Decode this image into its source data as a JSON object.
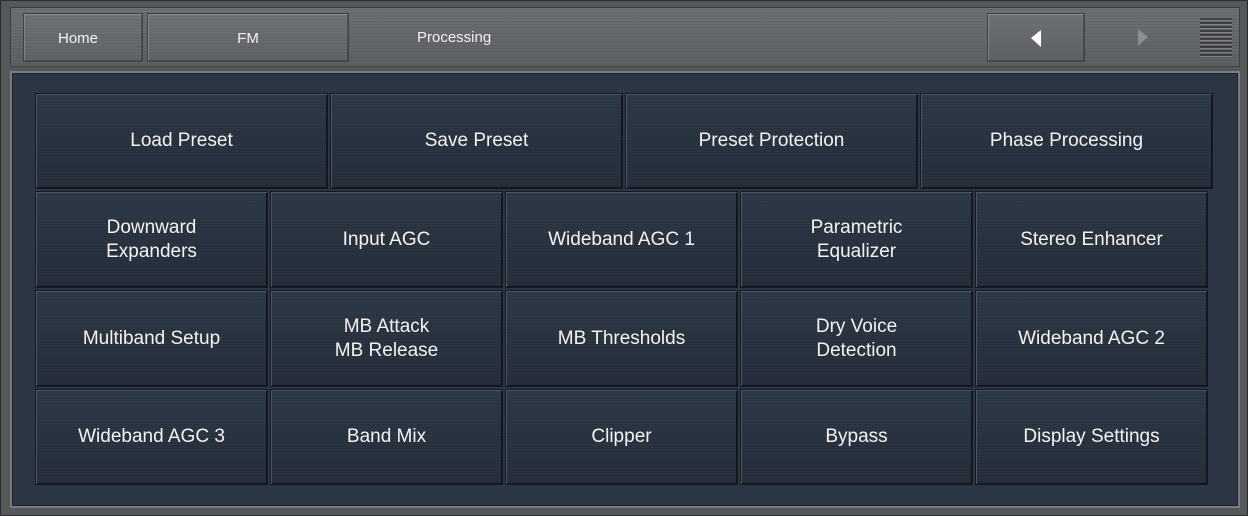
{
  "breadcrumb": {
    "home": "Home",
    "fm": "FM",
    "current": "Processing"
  },
  "nav": {
    "prev_icon": "chevron-left-icon",
    "next_icon": "chevron-right-icon",
    "menu_icon": "menu-lines-icon"
  },
  "colors": {
    "panel_bg": "#2b3543",
    "button_text": "#f1f3f5",
    "topbar_bg": "#63666a"
  },
  "rows": [
    [
      "Load Preset",
      "Save Preset",
      "Preset Protection",
      "Phase Processing"
    ],
    [
      "Downward\nExpanders",
      "Input AGC",
      "Wideband AGC 1",
      "Parametric\nEqualizer",
      "Stereo Enhancer"
    ],
    [
      "Multiband Setup",
      "MB Attack\nMB Release",
      "MB Thresholds",
      "Dry Voice\nDetection",
      "Wideband AGC 2"
    ],
    [
      "Wideband AGC 3",
      "Band Mix",
      "Clipper",
      "Bypass",
      "Display Settings"
    ]
  ]
}
